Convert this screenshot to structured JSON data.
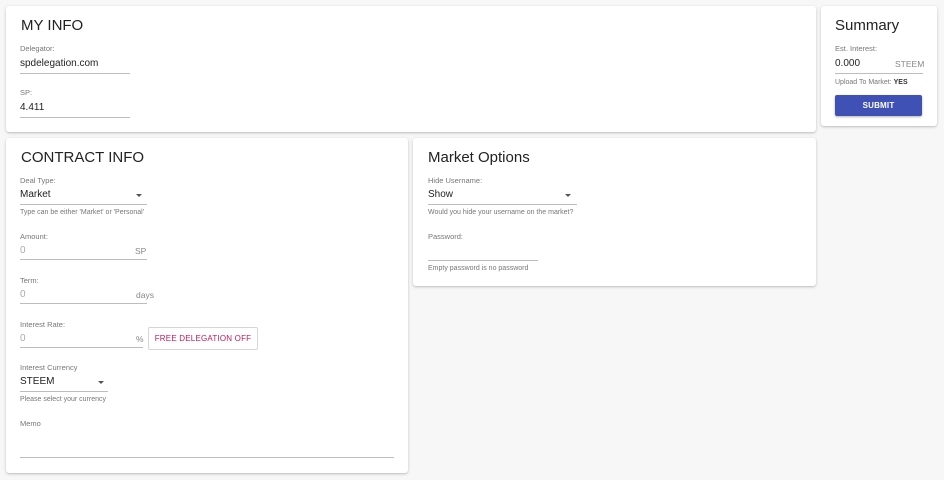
{
  "my_info": {
    "title": "MY INFO",
    "delegator_label": "Delegator:",
    "delegator_value": "spdelegation.com",
    "sp_label": "SP:",
    "sp_value": "4.411"
  },
  "summary": {
    "title": "Summary",
    "est_interest_label": "Est. Interest:",
    "est_interest_value": "0.000",
    "est_interest_unit": "STEEM",
    "upload_label": "Upload To Market:",
    "upload_value": "YES",
    "submit_label": "SUBMIT"
  },
  "contract_info": {
    "title": "CONTRACT INFO",
    "deal_type_label": "Deal Type:",
    "deal_type_value": "Market",
    "deal_type_helper": "Type can be either 'Market' or 'Personal'",
    "amount_label": "Amount:",
    "amount_placeholder": "0",
    "amount_unit": "SP",
    "term_label": "Term:",
    "term_placeholder": "0",
    "term_unit": "days",
    "interest_rate_label": "Interest Rate:",
    "interest_rate_placeholder": "0",
    "interest_rate_unit": "%",
    "free_delegation_label": "FREE DELEGATION OFF",
    "interest_currency_label": "Interest Currency",
    "interest_currency_value": "STEEM",
    "interest_currency_helper": "Please select your currency",
    "memo_label": "Memo"
  },
  "market_options": {
    "title": "Market Options",
    "hide_username_label": "Hide Username:",
    "hide_username_value": "Show",
    "hide_username_helper": "Would you hide your username on the market?",
    "password_label": "Password:",
    "password_helper": "Empty password is no password"
  }
}
